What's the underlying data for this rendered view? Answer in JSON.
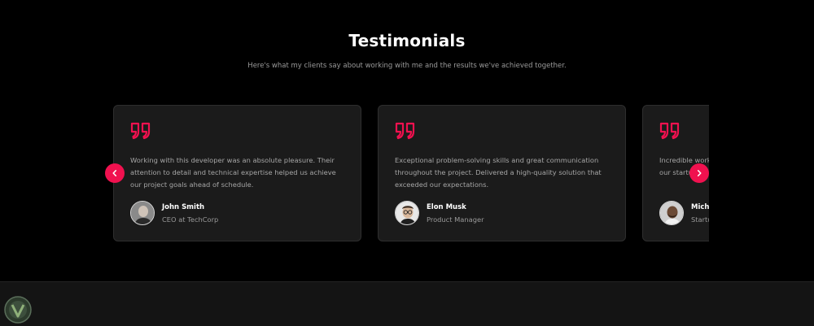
{
  "header": {
    "title": "Testimonials",
    "subtitle": "Here's what my clients say about working with me and the results we've achieved together."
  },
  "theme": {
    "accent": "#f0114f",
    "card_bg": "#1b1b1b",
    "page_bg": "#000000",
    "muted_text": "#a6a6a6"
  },
  "testimonials": [
    {
      "quote": "Working with this developer was an absolute pleasure. Their attention to detail and technical expertise helped us achieve our project goals ahead of schedule.",
      "name": "John Smith",
      "role": "CEO at TechCorp",
      "icon": "quote-icon"
    },
    {
      "quote": "Exceptional problem-solving skills and great communication throughout the project. Delivered a high-quality solution that exceeded our expectations.",
      "name": "Elon Musk",
      "role": "Product Manager",
      "icon": "quote-icon"
    },
    {
      "quote": "Incredible work our startup",
      "name": "Micha",
      "role": "Startu",
      "icon": "quote-icon"
    }
  ],
  "carousel": {
    "prev_icon": "chevron-left-icon",
    "next_icon": "chevron-right-icon"
  }
}
